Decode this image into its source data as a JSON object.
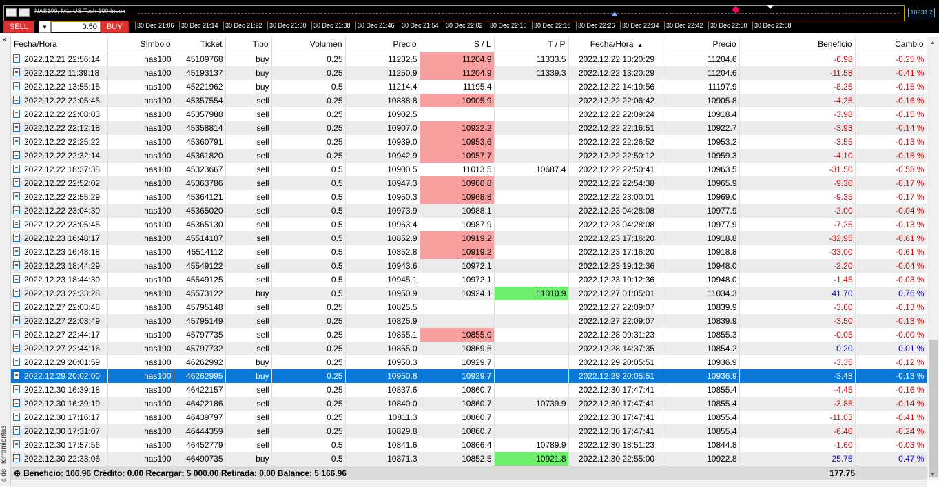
{
  "chart": {
    "title": "NAS100, M1: US Tech 100 Index",
    "price_tag": "10931.2",
    "sell_label": "SELL",
    "buy_label": "BUY",
    "lot_value": "0.50",
    "time_ticks": [
      "30 Dec 21:06",
      "30 Dec 21:14",
      "30 Dec 21:22",
      "30 Dec 21:30",
      "30 Dec 21:38",
      "30 Dec 21:46",
      "30 Dec 21:54",
      "30 Dec 22:02",
      "30 Dec 22:10",
      "30 Dec 22:18",
      "30 Dec 22:26",
      "30 Dec 22:34",
      "30 Dec 22:42",
      "30 Dec 22:50",
      "30 Dec 22:58"
    ]
  },
  "toolbox": {
    "close": "×",
    "vertical_label": "a de Herramientas"
  },
  "table": {
    "columns": [
      "Fecha/Hora",
      "Símbolo",
      "Ticket",
      "Tipo",
      "Volumen",
      "Precio",
      "S / L",
      "T / P",
      "Fecha/Hora",
      "Precio",
      "Beneficio",
      "Cambio"
    ],
    "sort_indicator": "▲",
    "rows": [
      {
        "open": "2022.12.21 22:56:14",
        "sym": "nas100",
        "ticket": "45109768",
        "type": "buy",
        "vol": "0.25",
        "price": "11232.5",
        "sl": "11204.9",
        "tp": "11333.5",
        "close": "2022.12.22 13:20:29",
        "cprice": "11204.6",
        "profit": "-6.98",
        "change": "-0.25 %",
        "sl_hit": true,
        "tp_hit": false
      },
      {
        "open": "2022.12.22 11:39:18",
        "sym": "nas100",
        "ticket": "45193137",
        "type": "buy",
        "vol": "0.25",
        "price": "11250.9",
        "sl": "11204.9",
        "tp": "11339.3",
        "close": "2022.12.22 13:20:29",
        "cprice": "11204.6",
        "profit": "-11.58",
        "change": "-0.41 %",
        "sl_hit": true,
        "tp_hit": false
      },
      {
        "open": "2022.12.22 13:55:15",
        "sym": "nas100",
        "ticket": "45221962",
        "type": "buy",
        "vol": "0.5",
        "price": "11214.4",
        "sl": "11195.4",
        "tp": "",
        "close": "2022.12.22 14:19:56",
        "cprice": "11197.9",
        "profit": "-8.25",
        "change": "-0.15 %",
        "sl_hit": false,
        "tp_hit": false
      },
      {
        "open": "2022.12.22 22:05:45",
        "sym": "nas100",
        "ticket": "45357554",
        "type": "sell",
        "vol": "0.25",
        "price": "10888.8",
        "sl": "10905.9",
        "tp": "",
        "close": "2022.12.22 22:06:42",
        "cprice": "10905.8",
        "profit": "-4.25",
        "change": "-0.16 %",
        "sl_hit": true,
        "tp_hit": false
      },
      {
        "open": "2022.12.22 22:08:03",
        "sym": "nas100",
        "ticket": "45357988",
        "type": "sell",
        "vol": "0.25",
        "price": "10902.5",
        "sl": "",
        "tp": "",
        "close": "2022.12.22 22:09:24",
        "cprice": "10918.4",
        "profit": "-3.98",
        "change": "-0.15 %",
        "sl_hit": false,
        "tp_hit": false
      },
      {
        "open": "2022.12.22 22:12:18",
        "sym": "nas100",
        "ticket": "45358814",
        "type": "sell",
        "vol": "0.25",
        "price": "10907.0",
        "sl": "10922.2",
        "tp": "",
        "close": "2022.12.22 22:16:51",
        "cprice": "10922.7",
        "profit": "-3.93",
        "change": "-0.14 %",
        "sl_hit": true,
        "tp_hit": false
      },
      {
        "open": "2022.12.22 22:25:22",
        "sym": "nas100",
        "ticket": "45360791",
        "type": "sell",
        "vol": "0.25",
        "price": "10939.0",
        "sl": "10953.6",
        "tp": "",
        "close": "2022.12.22 22:26:52",
        "cprice": "10953.2",
        "profit": "-3.55",
        "change": "-0.13 %",
        "sl_hit": true,
        "tp_hit": false
      },
      {
        "open": "2022.12.22 22:32:14",
        "sym": "nas100",
        "ticket": "45361820",
        "type": "sell",
        "vol": "0.25",
        "price": "10942.9",
        "sl": "10957.7",
        "tp": "",
        "close": "2022.12.22 22:50:12",
        "cprice": "10959.3",
        "profit": "-4.10",
        "change": "-0.15 %",
        "sl_hit": true,
        "tp_hit": false
      },
      {
        "open": "2022.12.22 18:37:38",
        "sym": "nas100",
        "ticket": "45323667",
        "type": "sell",
        "vol": "0.5",
        "price": "10900.5",
        "sl": "11013.5",
        "tp": "10687.4",
        "close": "2022.12.22 22:50:41",
        "cprice": "10963.5",
        "profit": "-31.50",
        "change": "-0.58 %",
        "sl_hit": false,
        "tp_hit": false
      },
      {
        "open": "2022.12.22 22:52:02",
        "sym": "nas100",
        "ticket": "45363786",
        "type": "sell",
        "vol": "0.5",
        "price": "10947.3",
        "sl": "10966.8",
        "tp": "",
        "close": "2022.12.22 22:54:38",
        "cprice": "10965.9",
        "profit": "-9.30",
        "change": "-0.17 %",
        "sl_hit": true,
        "tp_hit": false
      },
      {
        "open": "2022.12.22 22:55:29",
        "sym": "nas100",
        "ticket": "45364121",
        "type": "sell",
        "vol": "0.5",
        "price": "10950.3",
        "sl": "10968.8",
        "tp": "",
        "close": "2022.12.22 23:00:01",
        "cprice": "10969.0",
        "profit": "-9.35",
        "change": "-0.17 %",
        "sl_hit": true,
        "tp_hit": false
      },
      {
        "open": "2022.12.22 23:04:30",
        "sym": "nas100",
        "ticket": "45365020",
        "type": "sell",
        "vol": "0.5",
        "price": "10973.9",
        "sl": "10988.1",
        "tp": "",
        "close": "2022.12.23 04:28:08",
        "cprice": "10977.9",
        "profit": "-2.00",
        "change": "-0.04 %",
        "sl_hit": false,
        "tp_hit": false
      },
      {
        "open": "2022.12.22 23:05:45",
        "sym": "nas100",
        "ticket": "45365130",
        "type": "sell",
        "vol": "0.5",
        "price": "10963.4",
        "sl": "10987.9",
        "tp": "",
        "close": "2022.12.23 04:28:08",
        "cprice": "10977.9",
        "profit": "-7.25",
        "change": "-0.13 %",
        "sl_hit": false,
        "tp_hit": false
      },
      {
        "open": "2022.12.23 16:48:17",
        "sym": "nas100",
        "ticket": "45514107",
        "type": "sell",
        "vol": "0.5",
        "price": "10852.9",
        "sl": "10919.2",
        "tp": "",
        "close": "2022.12.23 17:16:20",
        "cprice": "10918.8",
        "profit": "-32.95",
        "change": "-0.61 %",
        "sl_hit": true,
        "tp_hit": false
      },
      {
        "open": "2022.12.23 16:48:18",
        "sym": "nas100",
        "ticket": "45514112",
        "type": "sell",
        "vol": "0.5",
        "price": "10852.8",
        "sl": "10919.2",
        "tp": "",
        "close": "2022.12.23 17:16:20",
        "cprice": "10918.8",
        "profit": "-33.00",
        "change": "-0.61 %",
        "sl_hit": true,
        "tp_hit": false
      },
      {
        "open": "2022.12.23 18:44:29",
        "sym": "nas100",
        "ticket": "45549122",
        "type": "sell",
        "vol": "0.5",
        "price": "10943.6",
        "sl": "10972.1",
        "tp": "",
        "close": "2022.12.23 19:12:36",
        "cprice": "10948.0",
        "profit": "-2.20",
        "change": "-0.04 %",
        "sl_hit": false,
        "tp_hit": false
      },
      {
        "open": "2022.12.23 18:44:30",
        "sym": "nas100",
        "ticket": "45549125",
        "type": "sell",
        "vol": "0.5",
        "price": "10945.1",
        "sl": "10972.1",
        "tp": "",
        "close": "2022.12.23 19:12:36",
        "cprice": "10948.0",
        "profit": "-1.45",
        "change": "-0.03 %",
        "sl_hit": false,
        "tp_hit": false
      },
      {
        "open": "2022.12.23 22:33:28",
        "sym": "nas100",
        "ticket": "45573122",
        "type": "buy",
        "vol": "0.5",
        "price": "10950.9",
        "sl": "10924.1",
        "tp": "11010.9",
        "close": "2022.12.27 01:05:01",
        "cprice": "11034.3",
        "profit": "41.70",
        "change": "0.76 %",
        "sl_hit": false,
        "tp_hit": true
      },
      {
        "open": "2022.12.27 22:03:48",
        "sym": "nas100",
        "ticket": "45795148",
        "type": "sell",
        "vol": "0.25",
        "price": "10825.5",
        "sl": "",
        "tp": "",
        "close": "2022.12.27 22:09:07",
        "cprice": "10839.9",
        "profit": "-3.60",
        "change": "-0.13 %",
        "sl_hit": false,
        "tp_hit": false
      },
      {
        "open": "2022.12.27 22:03:49",
        "sym": "nas100",
        "ticket": "45795149",
        "type": "sell",
        "vol": "0.25",
        "price": "10825.9",
        "sl": "",
        "tp": "",
        "close": "2022.12.27 22:09:07",
        "cprice": "10839.9",
        "profit": "-3.50",
        "change": "-0.13 %",
        "sl_hit": false,
        "tp_hit": false
      },
      {
        "open": "2022.12.27 22:44:17",
        "sym": "nas100",
        "ticket": "45797735",
        "type": "sell",
        "vol": "0.25",
        "price": "10855.1",
        "sl": "10855.0",
        "tp": "",
        "close": "2022.12.28 09:31:23",
        "cprice": "10855.3",
        "profit": "-0.05",
        "change": "-0.00 %",
        "sl_hit": true,
        "tp_hit": false
      },
      {
        "open": "2022.12.27 22:44:16",
        "sym": "nas100",
        "ticket": "45797732",
        "type": "sell",
        "vol": "0.25",
        "price": "10855.0",
        "sl": "10869.6",
        "tp": "",
        "close": "2022.12.28 14:37:35",
        "cprice": "10854.2",
        "profit": "0.20",
        "change": "0.01 %",
        "sl_hit": false,
        "tp_hit": false
      },
      {
        "open": "2022.12.29 20:01:59",
        "sym": "nas100",
        "ticket": "46262992",
        "type": "buy",
        "vol": "0.25",
        "price": "10950.3",
        "sl": "10929.7",
        "tp": "",
        "close": "2022.12.29 20:05:51",
        "cprice": "10936.9",
        "profit": "-3.35",
        "change": "-0.12 %",
        "sl_hit": false,
        "tp_hit": false
      },
      {
        "open": "2022.12.29 20:02:00",
        "sym": "nas100",
        "ticket": "46262995",
        "type": "buy",
        "vol": "0.25",
        "price": "10950.8",
        "sl": "10929.7",
        "tp": "",
        "close": "2022.12.29 20:05:51",
        "cprice": "10936.9",
        "profit": "-3.48",
        "change": "-0.13 %",
        "sl_hit": false,
        "tp_hit": false,
        "selected": true
      },
      {
        "open": "2022.12.30 16:39:18",
        "sym": "nas100",
        "ticket": "46422157",
        "type": "sell",
        "vol": "0.25",
        "price": "10837.6",
        "sl": "10860.7",
        "tp": "",
        "close": "2022.12.30 17:47:41",
        "cprice": "10855.4",
        "profit": "-4.45",
        "change": "-0.16 %",
        "sl_hit": false,
        "tp_hit": false
      },
      {
        "open": "2022.12.30 16:39:19",
        "sym": "nas100",
        "ticket": "46422186",
        "type": "sell",
        "vol": "0.25",
        "price": "10840.0",
        "sl": "10860.7",
        "tp": "10739.9",
        "close": "2022.12.30 17:47:41",
        "cprice": "10855.4",
        "profit": "-3.85",
        "change": "-0.14 %",
        "sl_hit": false,
        "tp_hit": false
      },
      {
        "open": "2022.12.30 17:16:17",
        "sym": "nas100",
        "ticket": "46439797",
        "type": "sell",
        "vol": "0.25",
        "price": "10811.3",
        "sl": "10860.7",
        "tp": "",
        "close": "2022.12.30 17:47:41",
        "cprice": "10855.4",
        "profit": "-11.03",
        "change": "-0.41 %",
        "sl_hit": false,
        "tp_hit": false
      },
      {
        "open": "2022.12.30 17:31:07",
        "sym": "nas100",
        "ticket": "46444359",
        "type": "sell",
        "vol": "0.25",
        "price": "10829.8",
        "sl": "10860.7",
        "tp": "",
        "close": "2022.12.30 17:47:41",
        "cprice": "10855.4",
        "profit": "-6.40",
        "change": "-0.24 %",
        "sl_hit": false,
        "tp_hit": false
      },
      {
        "open": "2022.12.30 17:57:56",
        "sym": "nas100",
        "ticket": "46452779",
        "type": "sell",
        "vol": "0.5",
        "price": "10841.6",
        "sl": "10866.4",
        "tp": "10789.9",
        "close": "2022.12.30 18:51:23",
        "cprice": "10844.8",
        "profit": "-1.60",
        "change": "-0.03 %",
        "sl_hit": false,
        "tp_hit": false
      },
      {
        "open": "2022.12.30 22:33:06",
        "sym": "nas100",
        "ticket": "46490735",
        "type": "buy",
        "vol": "0.5",
        "price": "10871.3",
        "sl": "10852.5",
        "tp": "10921.8",
        "close": "2022.12.30 22:55:00",
        "cprice": "10922.8",
        "profit": "25.75",
        "change": "0.47 %",
        "sl_hit": false,
        "tp_hit": true
      }
    ]
  },
  "summary": {
    "text": "Beneficio: 166.96  Crédito: 0.00  Recargar: 5 000.00  Retirada: 0.00  Balance: 5 166.96",
    "total": "177.75"
  },
  "colors": {
    "loss": "#e00000",
    "gain": "#0000e0",
    "sl_highlight": "#f8a0a0",
    "tp_highlight": "#6ef06e",
    "selection": "#0a78d7"
  }
}
